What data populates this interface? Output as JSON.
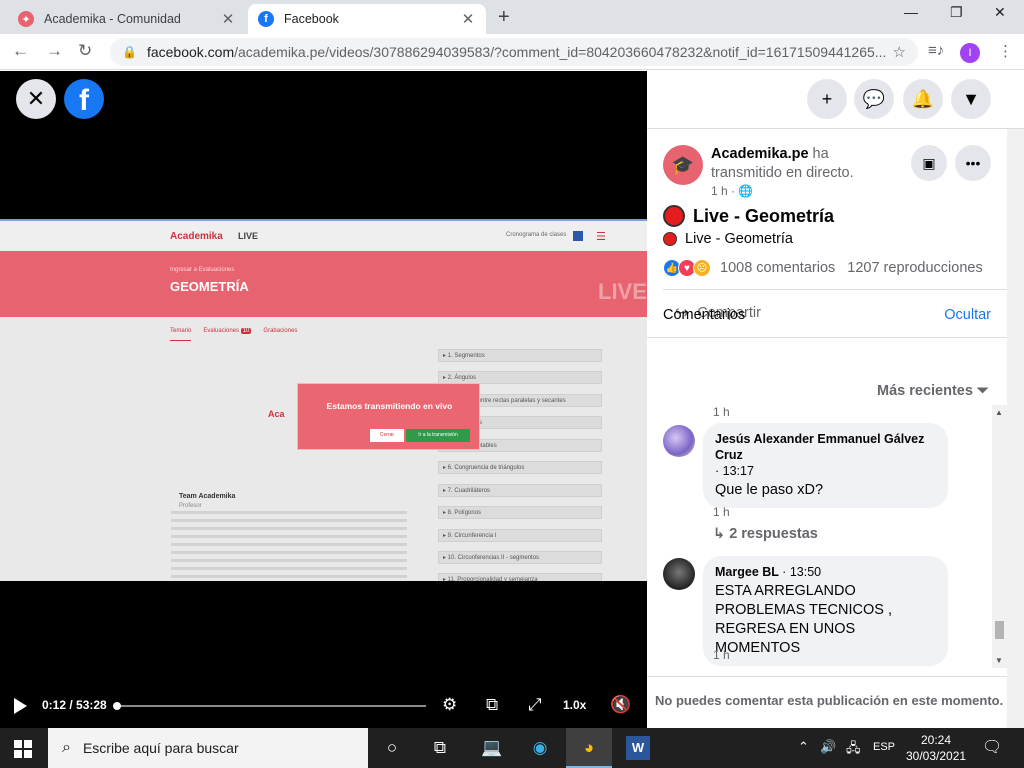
{
  "browser": {
    "tabs": [
      {
        "title": "Academika - Comunidad",
        "active": false
      },
      {
        "title": "Facebook",
        "active": true
      }
    ],
    "url_main": "facebook.com",
    "url_rest": "/academika.pe/videos/307886294039583/?comment_id=804203660478232&notif_id=16171509441265...",
    "profile_initial": "I"
  },
  "video": {
    "site": {
      "logo": "Academika",
      "live": "LIVE",
      "cronograma": "Cronograma de clases",
      "kicker": "Ingresar a Evaluaciones",
      "course_title": "GEOMETRÍA",
      "live_watermark": "LIVE",
      "subtabs": [
        "Temario",
        "Evaluaciones",
        "Grabaciones"
      ],
      "eval_badge": "10",
      "topics": [
        "▸ 1. Segmentos",
        "▸ 2. Ángulos",
        "▸ 3. Ángulos entre rectas paralelas y secantes",
        "▸ 4. Triángulos",
        "▸ 5. Líneas notables",
        "▸ 6. Congruencia de triángulos",
        "▸ 7. Cuadriláteros",
        "▸ 8. Polígonos",
        "▸ 9. Circunferencia I",
        "▸ 10. Circunferencias II - segmentos",
        "▸ 11. Proporcionalidad y semejanza"
      ],
      "team_name": "Team Academika",
      "team_role": "Profesor",
      "badge": "Aca"
    },
    "modal": {
      "title": "Estamos transmitiendo en vivo",
      "btn_close": "Cerrar",
      "btn_go": "Ir a la transmisión"
    },
    "controls": {
      "time": "0:12 / 53:28",
      "progress_fraction": 0.0037,
      "speed": "1.0x"
    }
  },
  "panel": {
    "post": {
      "page_name": "Academika.pe",
      "action": " ha transmitido en directo.",
      "meta": "1 h ·",
      "title": "Live - Geometría",
      "subtitle": "Live - Geometría",
      "comments": "1008 comentarios",
      "views": "1207 reproducciones",
      "share": "Compartir"
    },
    "comments_header": {
      "title": "Comentarios",
      "hide": "Ocultar",
      "sort": "Más recientes"
    },
    "comments": [
      {
        "top_ts": "1 h",
        "author": "Jesús Alexander Emmanuel Gálvez Cruz",
        "time": "13:17",
        "text": "Que le paso xD?",
        "ts": "1 h",
        "replies": "2 respuestas"
      },
      {
        "author": "Margee BL",
        "time": "13:50",
        "text": "ESTA ARREGLANDO PROBLEMAS TECNICOS , REGRESA EN UNOS MOMENTOS",
        "ts": "1 h"
      }
    ],
    "footer": "No puedes comentar esta publicación en este momento."
  },
  "taskbar": {
    "search": "Escribe aquí para buscar",
    "lang": "ESP",
    "time": "20:24",
    "date": "30/03/2021"
  },
  "colors": {
    "facebook_blue": "#1877f2",
    "academika_red": "#e6636f",
    "live_red": "#e41e1e"
  }
}
